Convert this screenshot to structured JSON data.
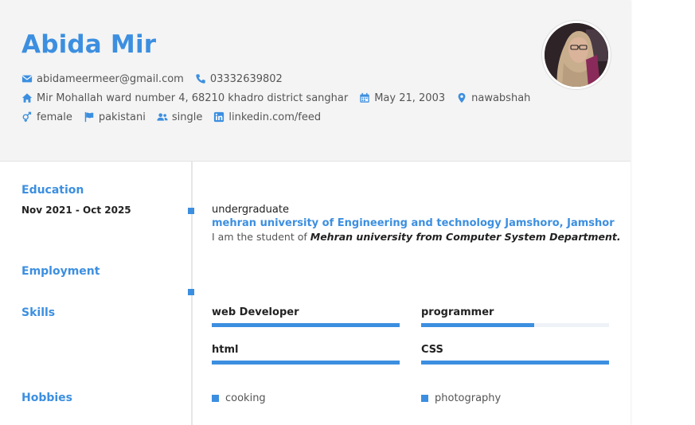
{
  "profile": {
    "name": "Abida Mir",
    "email": "abidameermeer@gmail.com",
    "phone": "03332639802",
    "address": "Mir Mohallah ward number 4, 68210 khadro district sanghar",
    "birthdate": "May 21, 2003",
    "city": "nawabshah",
    "gender": "female",
    "nationality": "pakistani",
    "marital_status": "single",
    "linkedin": "linkedin.com/feed"
  },
  "sections": {
    "education": "Education",
    "employment": "Employment",
    "skills": "Skills",
    "hobbies": "Hobbies"
  },
  "education": {
    "date": "Nov 2021 - Oct 2025",
    "degree": "undergraduate",
    "school": "mehran university of Engineering and technology Jamshoro, Jamshor",
    "description_prefix": "I am the student of ",
    "description_emphasis": "Mehran university from Computer System Department."
  },
  "skills": [
    {
      "name": "web Developer",
      "level": 1.0
    },
    {
      "name": "programmer",
      "level": 0.6
    },
    {
      "name": "html",
      "level": 1.0
    },
    {
      "name": "CSS",
      "level": 1.0
    }
  ],
  "hobbies": [
    "cooking",
    "photography"
  ],
  "colors": {
    "accent": "#3c8fe0",
    "header_bg": "#f4f4f4"
  },
  "icons": {
    "email": "envelope-icon",
    "phone": "phone-icon",
    "address": "home-icon",
    "birthdate": "calendar-icon",
    "city": "map-marker-icon",
    "gender": "gender-icon",
    "nationality": "flag-icon",
    "marital_status": "users-icon",
    "linkedin": "linkedin-icon"
  }
}
